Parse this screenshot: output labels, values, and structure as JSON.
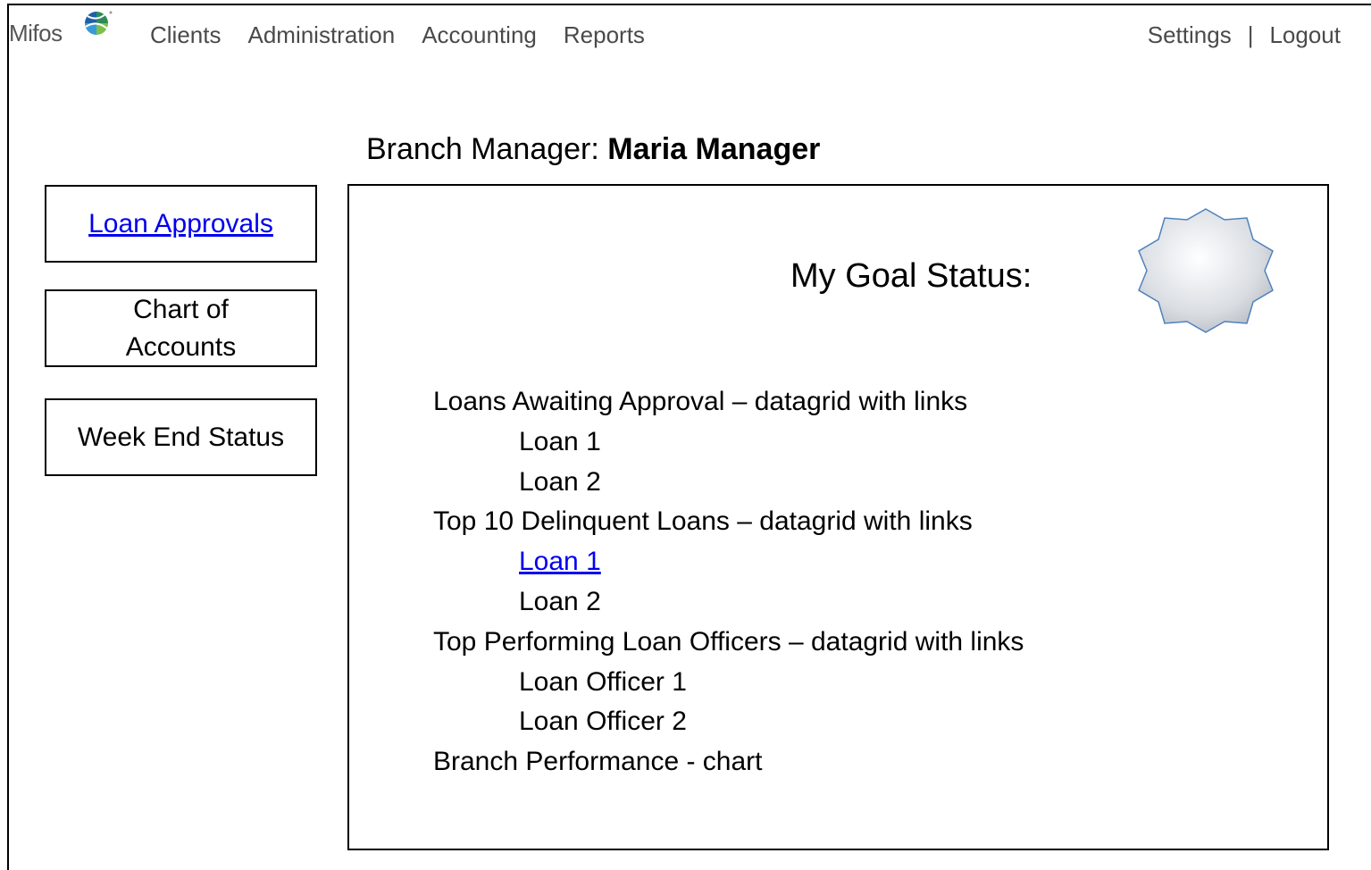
{
  "app": {
    "logo_text": "Mifos"
  },
  "topnav": {
    "items": [
      "Clients",
      "Administration",
      "Accounting",
      "Reports"
    ]
  },
  "toplinks": {
    "settings": "Settings",
    "separator": "|",
    "logout": "Logout"
  },
  "heading": {
    "role": "Branch Manager: ",
    "name": "Maria Manager"
  },
  "sidebar": {
    "items": [
      {
        "label": "Loan Approvals"
      },
      {
        "label": "Chart of Accounts"
      },
      {
        "label": "Week End Status"
      }
    ]
  },
  "main": {
    "goal_title": "My Goal Status:",
    "sections": [
      {
        "title": "Loans Awaiting Approval – datagrid with links",
        "items": [
          "Loan 1",
          "Loan 2"
        ]
      },
      {
        "title": "Top 10 Delinquent Loans – datagrid with links",
        "items": [
          "Loan 1",
          "Loan 2"
        ]
      },
      {
        "title": "Top Performing Loan Officers – datagrid with links",
        "items": [
          "Loan Officer 1",
          "Loan Officer 2"
        ]
      },
      {
        "title": "Branch Performance - chart",
        "items": []
      }
    ]
  },
  "colors": {
    "link": "#0000ee",
    "nav_text": "#4a4a4a",
    "badge_stroke": "#4f81bd"
  }
}
